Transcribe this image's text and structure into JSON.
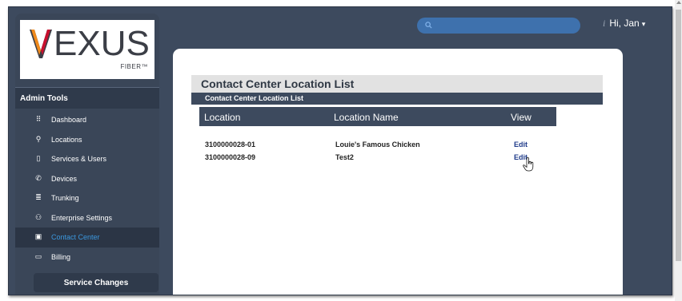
{
  "header": {
    "search": {
      "placeholder": "",
      "icon": "search-icon"
    },
    "user_icon": "info-icon",
    "user_glyph": "i",
    "user_greeting": "Hi, Jan",
    "user_caret": "▾"
  },
  "logo": {
    "text": "EXUS",
    "subtext": "FIBER™"
  },
  "sidebar": {
    "section_title": "Admin Tools",
    "items": [
      {
        "label": "Dashboard",
        "icon": "grid-icon",
        "glyph": "⠿",
        "active": false
      },
      {
        "label": "Locations",
        "icon": "map-pin-icon",
        "glyph": "⚲",
        "active": false
      },
      {
        "label": "Services & Users",
        "icon": "services-icon",
        "glyph": "▯",
        "active": false
      },
      {
        "label": "Devices",
        "icon": "phone-icon",
        "glyph": "✆",
        "active": false
      },
      {
        "label": "Trunking",
        "icon": "trunking-icon",
        "glyph": "≣",
        "active": false
      },
      {
        "label": "Enterprise Settings",
        "icon": "sitemap-icon",
        "glyph": "⚇",
        "active": false
      },
      {
        "label": "Contact Center",
        "icon": "contact-center-icon",
        "glyph": "▣",
        "active": true
      },
      {
        "label": "Billing",
        "icon": "credit-card-icon",
        "glyph": "▭",
        "active": false
      }
    ],
    "service_changes_label": "Service Changes"
  },
  "main": {
    "title": "Contact Center Location List",
    "subtitle": "Contact Center Location List",
    "table": {
      "columns": [
        "Location",
        "Location Name",
        "View"
      ],
      "rows": [
        {
          "location": "3100000028-01",
          "location_name": "Louie's Famous Chicken",
          "view": "Edit"
        },
        {
          "location": "3100000028-09",
          "location_name": "Test2",
          "view": "Edit"
        }
      ]
    }
  },
  "colors": {
    "frame_bg": "#3d4a5e",
    "sidebar_bg": "#3a4658",
    "active_item_text": "#3b97dd",
    "search_bg": "#3e71ad",
    "title_bar_bg": "#e2e2e2",
    "edit_link": "#1f3b8a",
    "logo_v_orange": "#f08a1c",
    "logo_v_red": "#c8102e"
  }
}
